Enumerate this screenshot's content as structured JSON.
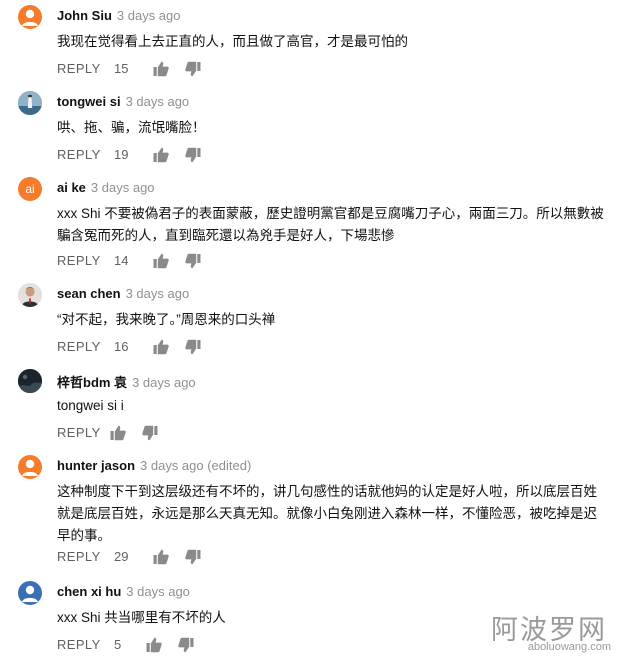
{
  "reply_label": "REPLY",
  "comments": [
    {
      "avatar_letter": "",
      "avatar_color": "#f57c2a",
      "author": "John Siu",
      "date": "3 days ago",
      "text": "我现在觉得看上去正直的人，而且做了高官，才是最可怕的",
      "likes": "15"
    },
    {
      "avatar_letter": "",
      "avatar_color": "#7f9fb5",
      "author": "tongwei si",
      "date": "3 days ago",
      "text": "哄、拖、骗，流氓嘴脸！",
      "likes": "19"
    },
    {
      "avatar_letter": "ai",
      "avatar_color": "#f57c2a",
      "author": "ai ke",
      "date": "3 days ago",
      "text": "xxx Shi  不要被偽君子的表面蒙蔽，歷史證明黨官都是豆腐嘴刀子心，兩面三刀。所以無數被騙含冤而死的人，直到臨死還以為兇手是好人，下場悲慘",
      "likes": "14"
    },
    {
      "avatar_letter": "",
      "avatar_color": "#6e5a4c",
      "author": "sean chen",
      "date": "3 days ago",
      "text": "“对不起，我来晚了。”周恩来的口头禅",
      "likes": "16"
    },
    {
      "avatar_letter": "",
      "avatar_color": "#1f2a33",
      "author": "梓哲bdm 袁",
      "date": "3 days ago",
      "text": "tongwei si i",
      "likes": ""
    },
    {
      "avatar_letter": "",
      "avatar_color": "#f57c2a",
      "author": "hunter jason",
      "date": "3 days ago (edited)",
      "text": "这种制度下干到这层级还有不坏的，讲几句感性的话就他妈的认定是好人啦，所以底层百姓就是底层百姓，永远是那么天真无知。就像小白兔刚进入森林一样，不懂险恶，被吃掉是迟早的事。",
      "likes": "29"
    },
    {
      "avatar_letter": "",
      "avatar_color": "#3b6fb6",
      "author": "chen xi hu",
      "date": "3 days ago",
      "text": "xxx Shi  共当哪里有不坏的人",
      "likes": "5"
    }
  ],
  "watermark": {
    "site_name": "阿波罗网",
    "url": "aboluowang.com"
  }
}
